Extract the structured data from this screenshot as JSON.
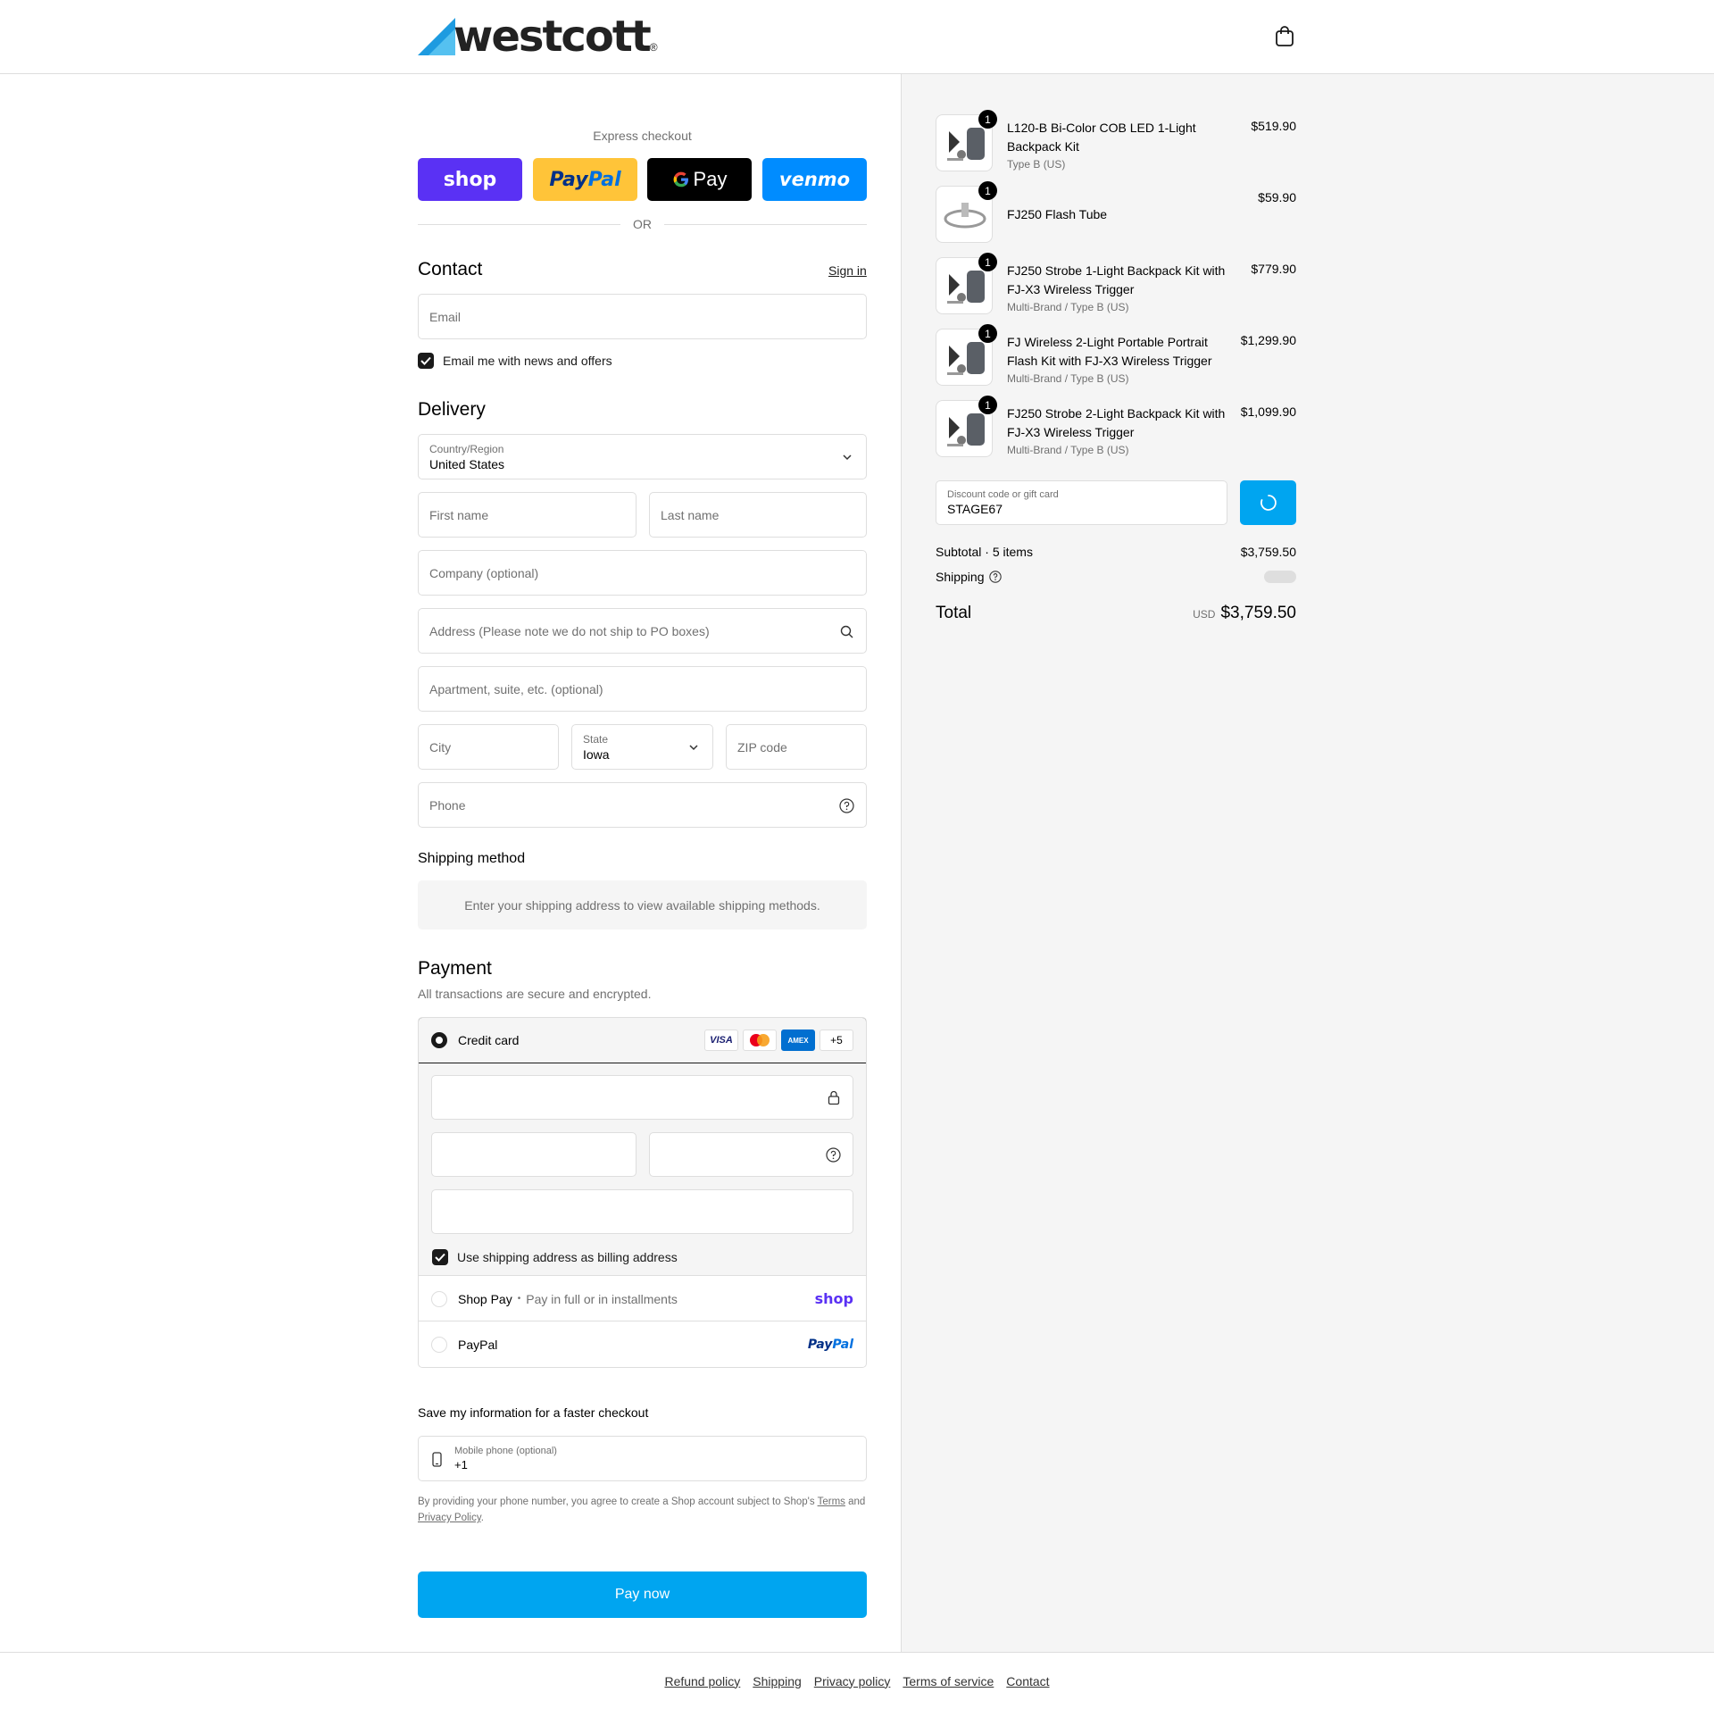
{
  "header": {
    "brand": "westcott",
    "brand_mark": "®"
  },
  "express": {
    "label": "Express checkout",
    "shop": "shop",
    "paypal_a": "Pay",
    "paypal_b": "Pal",
    "gpay": "Pay",
    "venmo": "venmo",
    "or": "OR"
  },
  "contact": {
    "title": "Contact",
    "sign_in": "Sign in",
    "email_placeholder": "Email",
    "news_label": "Email me with news and offers"
  },
  "delivery": {
    "title": "Delivery",
    "country_label": "Country/Region",
    "country_value": "United States",
    "first_name": "First name",
    "last_name": "Last name",
    "company": "Company (optional)",
    "address": "Address (Please note we do not ship to PO boxes)",
    "apartment": "Apartment, suite, etc. (optional)",
    "city": "City",
    "state_label": "State",
    "state_value": "Iowa",
    "zip": "ZIP code",
    "phone": "Phone"
  },
  "shipping_method": {
    "title": "Shipping method",
    "message": "Enter your shipping address to view available shipping methods."
  },
  "payment": {
    "title": "Payment",
    "subtitle": "All transactions are secure and encrypted.",
    "credit_card": "Credit card",
    "cards": [
      "VISA",
      "AMEX",
      "+5"
    ],
    "billing_label": "Use shipping address as billing address",
    "shop_pay": "Shop Pay",
    "shop_pay_sep": "•",
    "shop_pay_desc": "Pay in full or in installments",
    "shop_logo": "shop",
    "paypal": "PayPal",
    "paypal_logo_a": "Pay",
    "paypal_logo_b": "Pal"
  },
  "save_info": {
    "title": "Save my information for a faster checkout",
    "mobile_label": "Mobile phone (optional)",
    "mobile_value": "+1",
    "legal_1": "By providing your phone number, you agree to create a Shop account subject to Shop's",
    "terms": "Terms",
    "legal_and": "and",
    "privacy": "Privacy Policy",
    "legal_end": "."
  },
  "pay_now": "Pay now",
  "order": {
    "items": [
      {
        "qty": "1",
        "name": "L120-B Bi-Color COB LED 1-Light Backpack Kit",
        "variant": "Type B (US)",
        "price": "$519.90"
      },
      {
        "qty": "1",
        "name": "FJ250 Flash Tube",
        "variant": "",
        "price": "$59.90"
      },
      {
        "qty": "1",
        "name": "FJ250 Strobe 1-Light Backpack Kit with FJ-X3 Wireless Trigger",
        "variant": "Multi-Brand / Type B (US)",
        "price": "$779.90"
      },
      {
        "qty": "1",
        "name": "FJ Wireless 2-Light Portable Portrait Flash Kit with FJ-X3 Wireless Trigger",
        "variant": "Multi-Brand / Type B (US)",
        "price": "$1,299.90"
      },
      {
        "qty": "1",
        "name": "FJ250 Strobe 2-Light Backpack Kit with FJ-X3 Wireless Trigger",
        "variant": "Multi-Brand / Type B (US)",
        "price": "$1,099.90"
      }
    ],
    "discount_label": "Discount code or gift card",
    "discount_value": "STAGE67",
    "subtotal_label": "Subtotal · 5 items",
    "subtotal_value": "$3,759.50",
    "shipping_label": "Shipping",
    "total_label": "Total",
    "currency": "USD",
    "total_value": "$3,759.50"
  },
  "footer": [
    "Refund policy",
    "Shipping",
    "Privacy policy",
    "Terms of service",
    "Contact"
  ],
  "colors": {
    "accent": "#00a5f0",
    "shop": "#5a31f4",
    "paypal": "#ffc439",
    "venmo": "#008cff"
  }
}
